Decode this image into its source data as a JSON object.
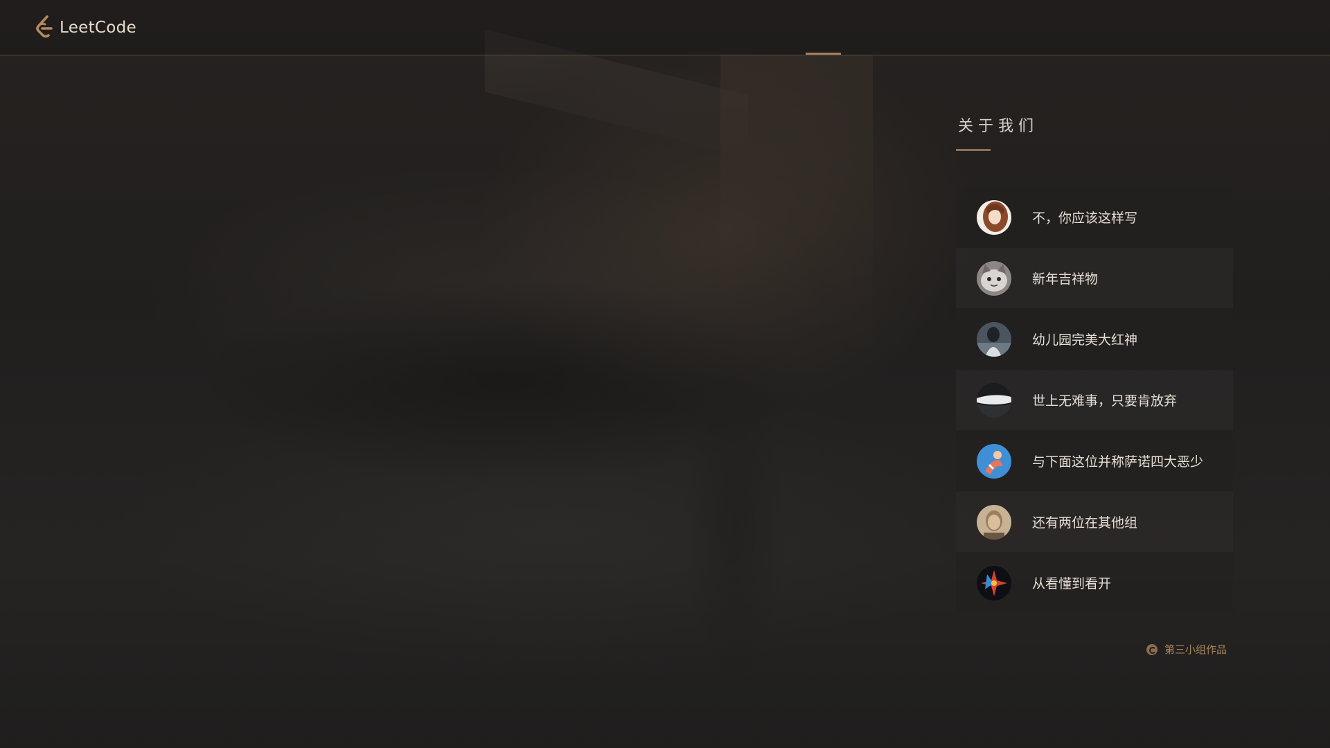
{
  "header": {
    "logo_text": "LeetCode"
  },
  "about": {
    "title": "关于我们",
    "members": [
      {
        "name": "不，你应该这样写",
        "avatar": "avatar-anime-girl"
      },
      {
        "name": "新年吉祥物",
        "avatar": "avatar-cat"
      },
      {
        "name": "幼儿园完美大红神",
        "avatar": "avatar-dark-figure"
      },
      {
        "name": "世上无难事，只要肯放弃",
        "avatar": "avatar-landscape"
      },
      {
        "name": "与下面这位并称萨诺四大恶少",
        "avatar": "avatar-blue-cartoon"
      },
      {
        "name": "还有两位在其他组",
        "avatar": "avatar-man-portrait"
      },
      {
        "name": "从看懂到看开",
        "avatar": "avatar-colorful-star"
      }
    ]
  },
  "footer": {
    "credit": "第三小组作品"
  },
  "colors": {
    "accent": "#a4805d",
    "text": "#e6ded6"
  }
}
